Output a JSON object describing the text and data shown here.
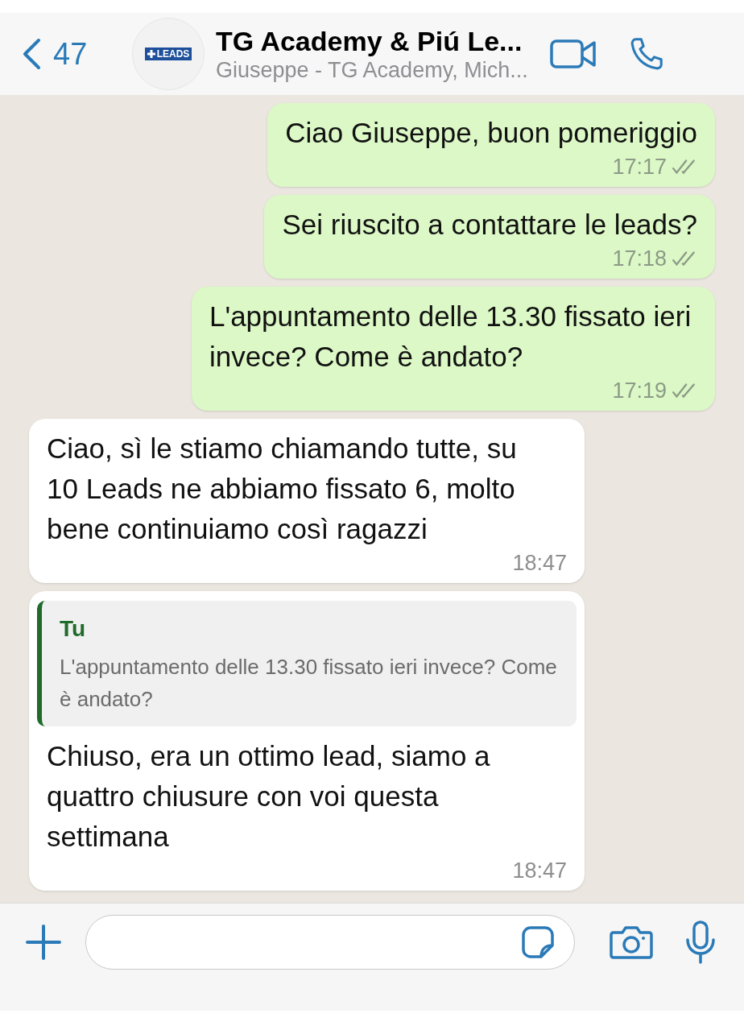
{
  "header": {
    "back_count": "47",
    "avatar_text": "LEADS",
    "title": "TG Academy & Piú Le...",
    "subtitle": "Giuseppe - TG Academy, Mich..."
  },
  "messages": [
    {
      "outgoing": true,
      "text": "Ciao Giuseppe, buon pomeriggio",
      "time": "17:17",
      "read": false
    },
    {
      "outgoing": true,
      "text": "Sei riuscito a contattare le leads?",
      "time": "17:18",
      "read": false
    },
    {
      "outgoing": true,
      "text": "L'appuntamento delle 13.30 fissato ieri invece? Come è andato?",
      "time": "17:19",
      "read": false
    },
    {
      "outgoing": false,
      "text": "Ciao, sì le stiamo chiamando tutte, su 10 Leads ne abbiamo fissato 6, molto bene continuiamo così ragazzi",
      "time": "18:47"
    },
    {
      "outgoing": false,
      "quote": {
        "author": "Tu",
        "text": "L'appuntamento delle 13.30 fissato ieri invece? Come è andato?"
      },
      "text": "Chiuso, era un ottimo lead, siamo a quattro chiusure con voi questa settimana",
      "time": "18:47"
    }
  ]
}
